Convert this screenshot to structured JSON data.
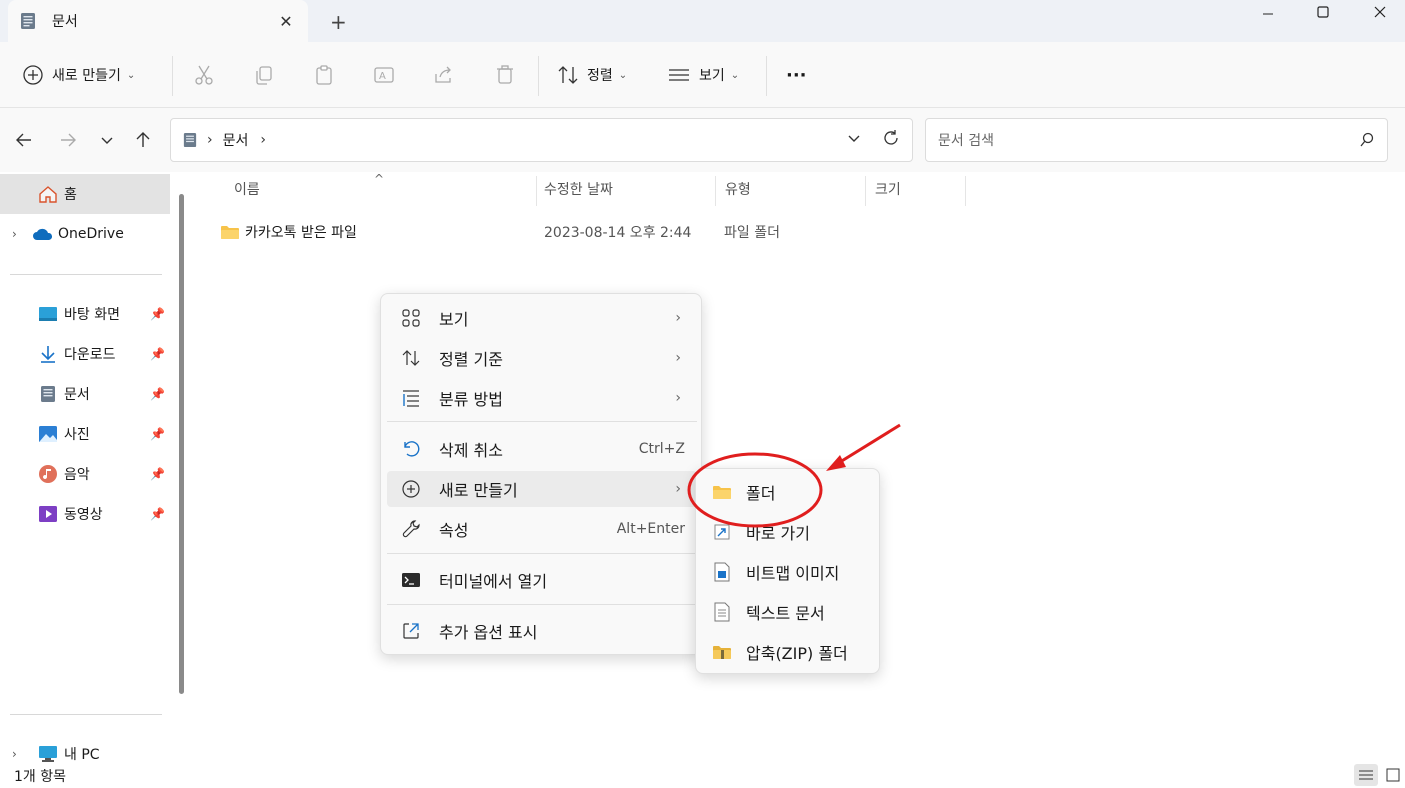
{
  "window": {
    "tab_title": "문서",
    "tab_close": "✕",
    "new_tab": "+"
  },
  "toolbar": {
    "new_label": "새로 만들기",
    "sort_label": "정렬",
    "view_label": "보기",
    "more_label": "···"
  },
  "address": {
    "location": "문서",
    "search_placeholder": "문서 검색"
  },
  "sidebar": {
    "home": "홈",
    "onedrive": "OneDrive",
    "quick_access": [
      {
        "label": "바탕 화면",
        "icon": "desktop-icon"
      },
      {
        "label": "다운로드",
        "icon": "download-icon"
      },
      {
        "label": "문서",
        "icon": "documents-icon"
      },
      {
        "label": "사진",
        "icon": "pictures-icon"
      },
      {
        "label": "음악",
        "icon": "music-icon"
      },
      {
        "label": "동영상",
        "icon": "videos-icon"
      }
    ],
    "this_pc": "내 PC"
  },
  "file_list": {
    "columns": [
      "이름",
      "수정한 날짜",
      "유형",
      "크기"
    ],
    "rows": [
      {
        "name": "카카오톡 받은 파일",
        "modified": "2023-08-14 오후 2:44",
        "type": "파일 폴더",
        "size": ""
      }
    ]
  },
  "context_menu": {
    "items": [
      {
        "label": "보기",
        "shortcut": "",
        "arrow": true
      },
      {
        "label": "정렬 기준",
        "shortcut": "",
        "arrow": true
      },
      {
        "label": "분류 방법",
        "shortcut": "",
        "arrow": true
      },
      {
        "label": "삭제 취소",
        "shortcut": "Ctrl+Z",
        "arrow": false
      },
      {
        "label": "새로 만들기",
        "shortcut": "",
        "arrow": true
      },
      {
        "label": "속성",
        "shortcut": "Alt+Enter",
        "arrow": false
      },
      {
        "label": "터미널에서 열기",
        "shortcut": "",
        "arrow": false
      },
      {
        "label": "추가 옵션 표시",
        "shortcut": "",
        "arrow": false
      }
    ],
    "arrow_glyph": "›"
  },
  "new_submenu": {
    "items": [
      "폴더",
      "바로 가기",
      "비트맵 이미지",
      "텍스트 문서",
      "압축(ZIP) 폴더"
    ]
  },
  "status": {
    "item_count": "1개 항목"
  },
  "colors": {
    "annotation_red": "#e01e1e",
    "folder_yellow": "#f7c34a",
    "accent_blue": "#0067c0"
  }
}
